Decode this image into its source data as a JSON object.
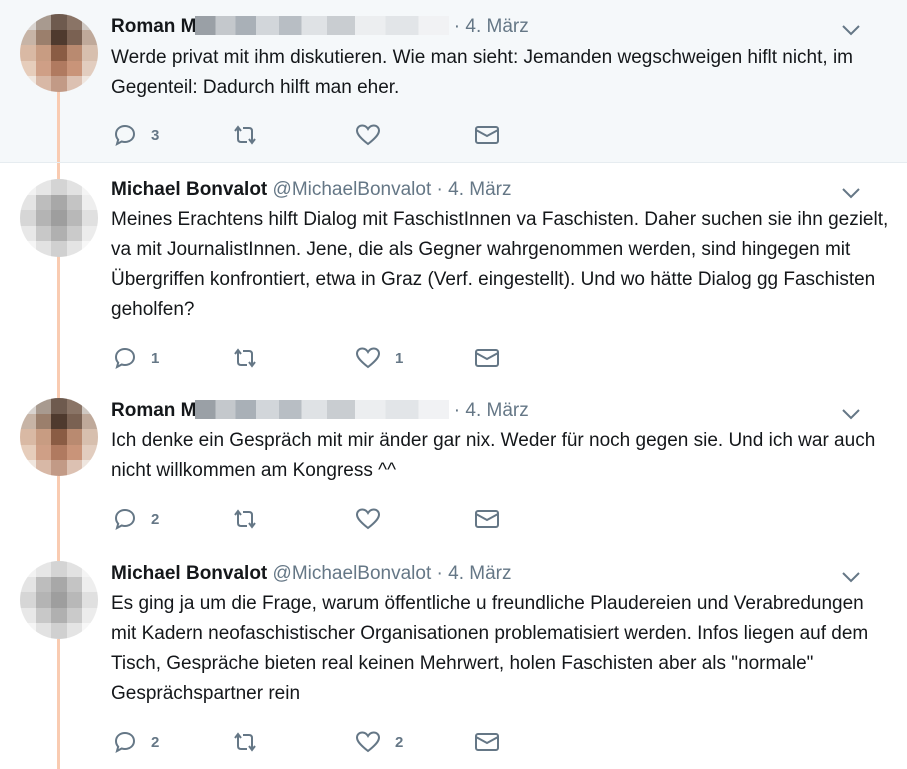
{
  "colors": {
    "thread_line": "#f9cbb1",
    "highlight_bg": "#f5f8fa",
    "text": "#14171a",
    "secondary": "#657786"
  },
  "tweets": [
    {
      "name": "Roman M",
      "handle": "",
      "sep": "·",
      "date": "4. März",
      "text": "Werde privat mit ihm diskutieren. Wie man sieht: Jemanden wegschweigen hiflt nicht, im Gegenteil: Dadurch hilft man eher.",
      "reply_count": "3",
      "like_count": ""
    },
    {
      "name": "Michael Bonvalot",
      "handle": "@MichaelBonvalot",
      "sep": "·",
      "date": "4. März",
      "text": "Meines Erachtens hilft Dialog mit FaschistInnen va Faschisten. Daher suchen sie ihn gezielt, va mit JournalistInnen. Jene, die als Gegner wahrgenommen werden, sind hingegen mit Übergriffen konfrontiert, etwa in Graz (Verf. eingestellt). Und wo hätte Dialog gg Faschisten geholfen?",
      "reply_count": "1",
      "like_count": "1"
    },
    {
      "name": "Roman M",
      "handle": "",
      "sep": "·",
      "date": "4. März",
      "text": "Ich denke ein Gespräch mit mir änder gar nix. Weder für noch gegen sie. Und ich war auch nicht willkommen am Kongress ^^",
      "reply_count": "2",
      "like_count": ""
    },
    {
      "name": "Michael Bonvalot",
      "handle": "@MichaelBonvalot",
      "sep": "·",
      "date": "4. März",
      "text": "Es ging ja um die Frage, warum öffentliche u freundliche Plaudereien und Verabredungen mit Kadern neofaschistischer Organisationen problematisiert werden. Infos liegen auf dem Tisch, Gespräche bieten real keinen Mehrwert, holen Faschisten aber als \"normale\" Gesprächspartner rein",
      "reply_count": "2",
      "like_count": "2"
    }
  ]
}
